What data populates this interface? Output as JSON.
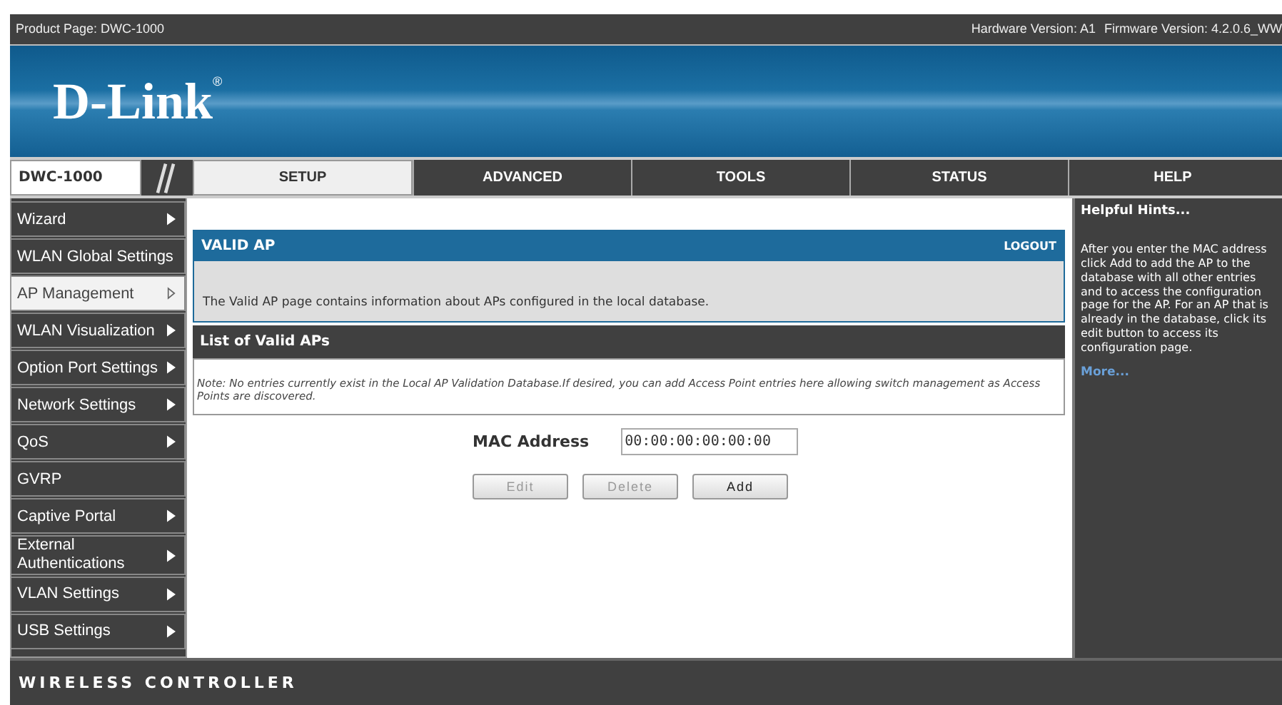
{
  "top_bar": {
    "product": "Product Page: DWC-1000",
    "hardware": "Hardware Version: A1",
    "firmware": "Firmware Version: 4.2.0.6_WW"
  },
  "logo": {
    "text": "D-Link",
    "mark": "®"
  },
  "model": "DWC-1000",
  "tabs": [
    {
      "label": "SETUP",
      "selected": true
    },
    {
      "label": "ADVANCED",
      "selected": false
    },
    {
      "label": "TOOLS",
      "selected": false
    },
    {
      "label": "STATUS",
      "selected": false
    },
    {
      "label": "HELP",
      "selected": false
    }
  ],
  "sidebar": {
    "items": [
      {
        "label": "Wizard",
        "has_submenu": true,
        "selected": false
      },
      {
        "label": "WLAN Global Settings",
        "has_submenu": false,
        "selected": false
      },
      {
        "label": "AP Management",
        "has_submenu": true,
        "selected": true
      },
      {
        "label": "WLAN Visualization",
        "has_submenu": true,
        "selected": false
      },
      {
        "label": "Option Port Settings",
        "has_submenu": true,
        "selected": false
      },
      {
        "label": "Network Settings",
        "has_submenu": true,
        "selected": false
      },
      {
        "label": "QoS",
        "has_submenu": true,
        "selected": false
      },
      {
        "label": "GVRP",
        "has_submenu": false,
        "selected": false
      },
      {
        "label": "Captive Portal",
        "has_submenu": true,
        "selected": false
      },
      {
        "label": "External Authentications",
        "has_submenu": true,
        "selected": false
      },
      {
        "label": "VLAN Settings",
        "has_submenu": true,
        "selected": false
      },
      {
        "label": "USB Settings",
        "has_submenu": true,
        "selected": false
      }
    ]
  },
  "section": {
    "title": "VALID AP",
    "logout": "LOGOUT",
    "description": "The Valid AP page contains information about APs configured in the local database."
  },
  "list": {
    "title": "List of Valid APs",
    "note": "Note:  No entries currently exist in the Local AP Validation Database.If desired, you can add Access Point entries here allowing switch management as Access Points are discovered."
  },
  "form": {
    "label": "MAC Address",
    "value": "00:00:00:00:00:00"
  },
  "buttons": [
    {
      "label": "Edit",
      "disabled": true
    },
    {
      "label": "Delete",
      "disabled": true
    },
    {
      "label": "Add",
      "disabled": false
    }
  ],
  "help": {
    "title": "Helpful Hints...",
    "text": "After you enter the MAC address click Add to add the AP to the database with all other entries and to access the configuration page for the AP. For an AP that is already in the database, click its edit button to access its configuration page.",
    "more": "More..."
  },
  "footer": "WIRELESS CONTROLLER"
}
